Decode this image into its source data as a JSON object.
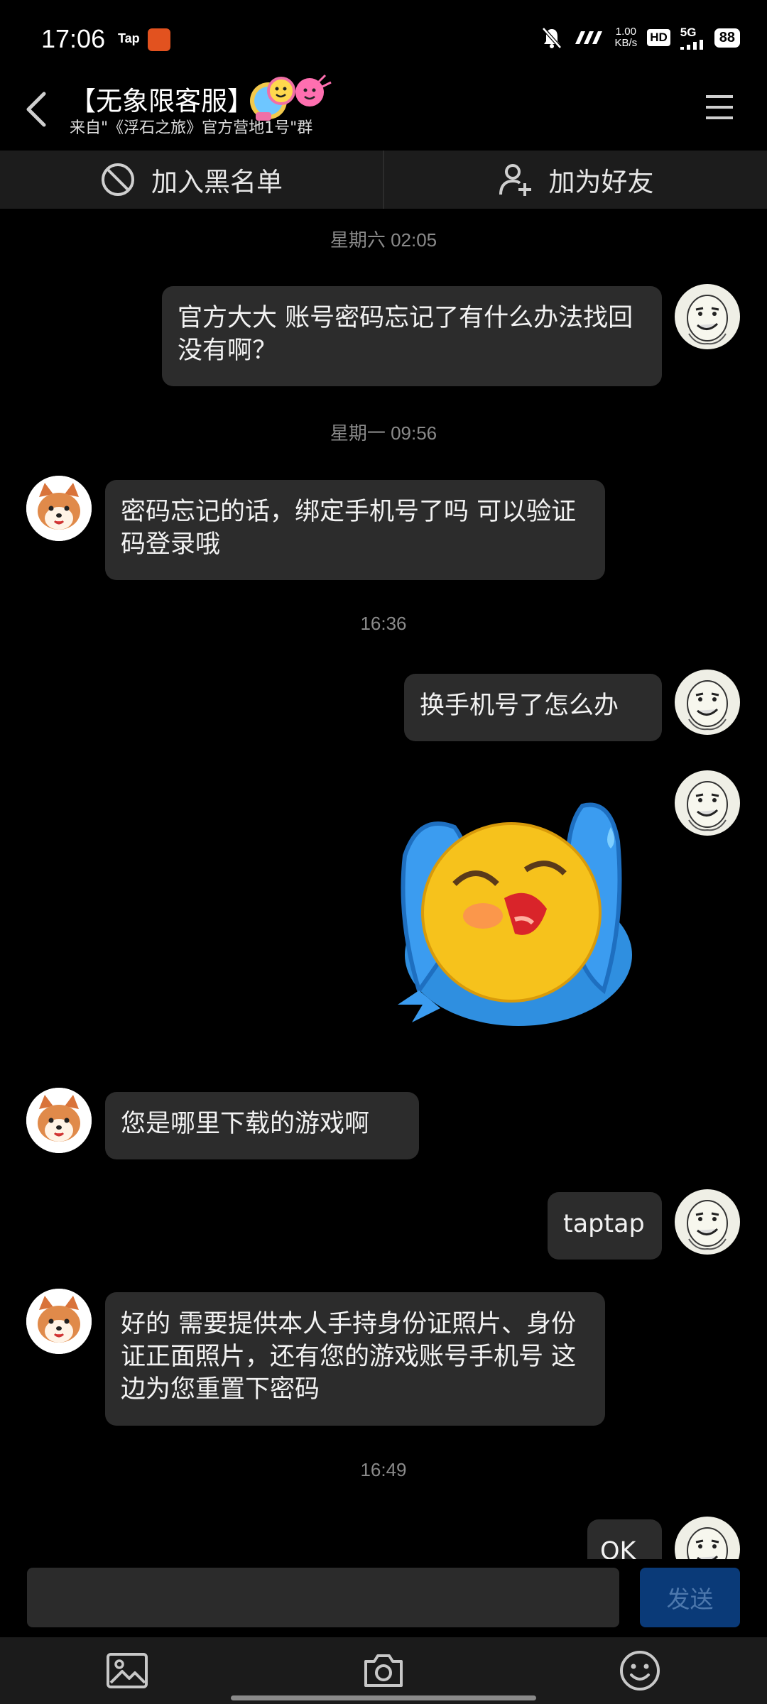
{
  "status": {
    "time": "17:06",
    "tap": "Tap",
    "speed_value": "1.00",
    "speed_unit": "KB/s",
    "hd": "HD",
    "network": "5G",
    "battery": "88"
  },
  "header": {
    "title": "【无象限客服】",
    "subtitle": "来自\"《浮石之旅》官方营地1号\"群"
  },
  "actions": {
    "block": "加入黑名单",
    "add_friend": "加为好友"
  },
  "chat": {
    "ts1": "星期六 02:05",
    "m1": "官方大大  账号密码忘记了有什么办法找回没有啊？",
    "ts2": "星期一 09:56",
    "m2": "密码忘记的话，绑定手机号了吗 可以验证码登录哦",
    "ts3": "16:36",
    "m3": "换手机号了怎么办",
    "m5": "您是哪里下载的游戏啊",
    "m6": "taptap",
    "m7": "好的 需要提供本人手持身份证照片、身份证正面照片，还有您的游戏账号手机号 这边为您重置下密码",
    "ts4": "16:49",
    "m8": "OK"
  },
  "input": {
    "send": "发送"
  },
  "icons": {
    "back": "back-arrow-icon",
    "menu": "menu-icon",
    "block": "block-icon",
    "add_friend": "add-user-icon",
    "sticker": "crying-emoji-sticker",
    "image": "image-icon",
    "camera": "camera-icon",
    "emoji": "emoji-icon"
  },
  "colors": {
    "background": "#000000",
    "bubble": "#2c2c2c",
    "send_button": "#0a3a78",
    "action_bar": "#1c1c1c"
  }
}
